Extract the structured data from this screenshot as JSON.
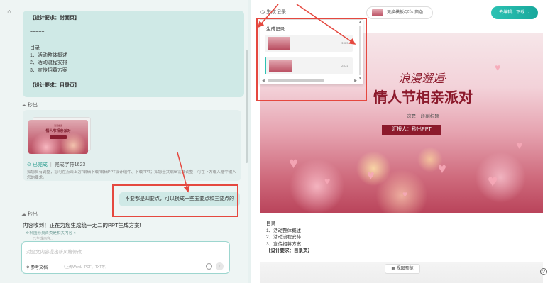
{
  "rail": {
    "home_icon": "home-icon",
    "menu_icon": "menu-icon"
  },
  "chat": {
    "bubble1": {
      "lines": [
        "【设计要求：封面页】",
        "",
        "=====",
        "",
        "目录",
        "1、活动整体概述",
        "2、活动流程安排",
        "3、宣传招募方案",
        "",
        "【设计要求：目录页】"
      ]
    },
    "assistant_name_1": "秒出",
    "card": {
      "thumb_small": "浪漫邂逅",
      "thumb_title": "情人节相亲派对",
      "status": "已完成",
      "count_label": "完成字符1623",
      "desc": "如您员有调整，您可在点击上方\"编辑下载\"编辑PPT设计组件、下载PPT；如您全文编辑需要调整，可在下方输入框中输入您的要求。"
    },
    "user_message": "不要都是四要点，可以换成一些五要点和三要点的",
    "assistant_name_2": "秒出",
    "reply": "内容收到！正在为您生成统一无二的PPT生成方案!",
    "ref_chip": "专科图形员首类是相关内容 ×",
    "ref_chip_sub": "已生成内容...",
    "input": {
      "placeholder": "对全文内容提出新风格修改...",
      "attach_label": "参考文档",
      "attach_hint": "（上传Word、PDF、TXT等）",
      "send": "↑"
    }
  },
  "right": {
    "gen_record": "生成记录",
    "template_btn": "更换模板/字体/颜色",
    "go_btn": "去编辑、下载 →",
    "dropdown": {
      "title": "生成记录",
      "items": [
        {
          "count": "1623"
        },
        {
          "count": "2831"
        }
      ]
    },
    "slide": {
      "h1": "浪漫邂逅·",
      "h2": "情人节相亲派对",
      "sub": "这是一段副标题",
      "reporter": "汇报人：秒出PPT"
    },
    "outline": [
      "目录",
      "1、活动整体概述",
      "2、活动流程安排",
      "3、宣传招募方案",
      "【设计要求：目录页】"
    ],
    "view_btn": "视图预览",
    "help": "?"
  },
  "colors": {
    "accent": "#2cc2b3",
    "highlight": "#e5483f",
    "slide_title": "#8c1a2c"
  }
}
